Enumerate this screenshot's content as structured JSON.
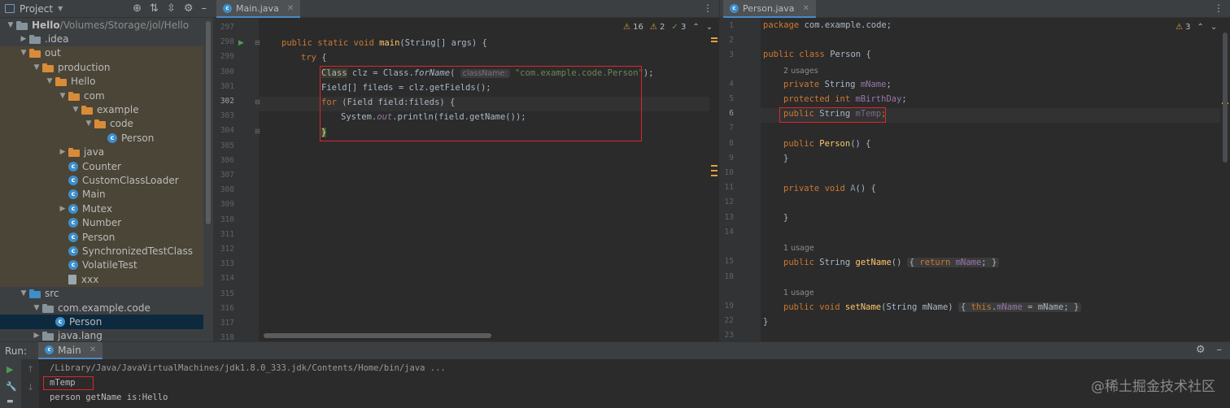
{
  "project": {
    "title": "Project",
    "tree": [
      {
        "label": "Hello",
        "extra": "/Volumes/Storage/jol/Hello",
        "indent": 0,
        "icon": "folder",
        "arrow": "down",
        "bold": true
      },
      {
        "label": ".idea",
        "indent": 1,
        "icon": "folder",
        "arrow": "right"
      },
      {
        "label": "out",
        "indent": 1,
        "icon": "folder-orange",
        "arrow": "down",
        "hl": true
      },
      {
        "label": "production",
        "indent": 2,
        "icon": "folder-orange",
        "arrow": "down",
        "hl": true
      },
      {
        "label": "Hello",
        "indent": 3,
        "icon": "folder-orange",
        "arrow": "down",
        "hl": true
      },
      {
        "label": "com",
        "indent": 4,
        "icon": "folder-orange",
        "arrow": "down",
        "hl": true
      },
      {
        "label": "example",
        "indent": 5,
        "icon": "folder-orange",
        "arrow": "down",
        "hl": true
      },
      {
        "label": "code",
        "indent": 6,
        "icon": "folder-orange",
        "arrow": "down",
        "hl": true
      },
      {
        "label": "Person",
        "indent": 7,
        "icon": "class",
        "arrow": "none",
        "hl": true
      },
      {
        "label": "java",
        "indent": 4,
        "icon": "folder-orange",
        "arrow": "right",
        "hl": true
      },
      {
        "label": "Counter",
        "indent": 4,
        "icon": "class",
        "arrow": "none",
        "hl": true
      },
      {
        "label": "CustomClassLoader",
        "indent": 4,
        "icon": "class",
        "arrow": "none",
        "hl": true
      },
      {
        "label": "Main",
        "indent": 4,
        "icon": "class",
        "arrow": "none",
        "hl": true
      },
      {
        "label": "Mutex",
        "indent": 4,
        "icon": "class",
        "arrow": "right",
        "hl": true
      },
      {
        "label": "Number",
        "indent": 4,
        "icon": "class",
        "arrow": "none",
        "hl": true
      },
      {
        "label": "Person",
        "indent": 4,
        "icon": "class",
        "arrow": "none",
        "hl": true
      },
      {
        "label": "SynchronizedTestClass",
        "indent": 4,
        "icon": "class",
        "arrow": "none",
        "hl": true
      },
      {
        "label": "VolatileTest",
        "indent": 4,
        "icon": "class",
        "arrow": "none",
        "hl": true
      },
      {
        "label": "xxx",
        "indent": 4,
        "icon": "file",
        "arrow": "none",
        "hl": true
      },
      {
        "label": "src",
        "indent": 1,
        "icon": "folder-blue",
        "arrow": "down"
      },
      {
        "label": "com.example.code",
        "indent": 2,
        "icon": "folder",
        "arrow": "down"
      },
      {
        "label": "Person",
        "indent": 3,
        "icon": "class",
        "arrow": "none",
        "selected": true
      },
      {
        "label": "java.lang",
        "indent": 2,
        "icon": "folder",
        "arrow": "right"
      }
    ]
  },
  "editor1": {
    "tab": "Main.java",
    "warnings": {
      "w": "16",
      "weak": "2",
      "ok": "3"
    },
    "line_numbers": [
      "297",
      "298",
      "299",
      "300",
      "301",
      "302",
      "303",
      "304",
      "305",
      "306",
      "307",
      "308",
      "309",
      "310",
      "311",
      "312",
      "313",
      "314",
      "315",
      "316",
      "317",
      "318"
    ],
    "current_line": "302",
    "code": {
      "l298_kw": "public static void ",
      "l298_fn": "main",
      "l298_rest": "(String[] args) {",
      "l299_kw": "try",
      "l299_rest": " {",
      "l300_a": "Class",
      "l300_b": " clz = Class.",
      "l300_c": "forName",
      "l300_d": "(",
      "l300_hint": "className:",
      "l300_str": "\"com.example.code.Person\"",
      "l300_e": ");",
      "l301": "Field[] fileds = clz.getFields();",
      "l302_kw": "for",
      "l302_rest": " (Field field:fileds) {",
      "l303_a": "System.",
      "l303_out": "out",
      "l303_b": ".println(field.getName());",
      "l304": "}"
    }
  },
  "editor2": {
    "tab": "Person.java",
    "warnings": "3",
    "line_numbers": [
      "1",
      "2",
      "3",
      "",
      "4",
      "5",
      "6",
      "7",
      "8",
      "9",
      "10",
      "11",
      "12",
      "13",
      "14",
      "",
      "15",
      "18",
      "",
      "19",
      "22",
      "23"
    ],
    "current_line": "6",
    "code": {
      "l1_kw": "package",
      "l1_rest": " com.example.code;",
      "l3_kw": "public class ",
      "l3_rest": "Person {",
      "u1": "2 usages",
      "l4_kw": "private ",
      "l4_t": "String ",
      "l4_f": "mName",
      "l4_s": ";",
      "l5_kw": "protected int ",
      "l5_f": "mBirthDay",
      "l5_s": ";",
      "l6_kw": "public ",
      "l6_t": "String ",
      "l6_f": "mTemp",
      "l6_s": ";",
      "l8_kw": "public ",
      "l8_fn": "Person",
      "l8_rest": "() {",
      "l9": "}",
      "l11_kw": "private void ",
      "l11_fn": "A",
      "l11_rest": "() {",
      "l13": "}",
      "u2": "1 usage",
      "l15_kw": "public ",
      "l15_t": "String ",
      "l15_fn": "getName",
      "l15_p": "() ",
      "l15_h1": "{ ",
      "l15_ret": "return ",
      "l15_f": "mName",
      "l15_h2": "; }",
      "u3": "1 usage",
      "l19_kw": "public void ",
      "l19_fn": "setName",
      "l19_p": "(String mName) ",
      "l19_h1": "{ ",
      "l19_this": "this",
      "l19_dot": ".",
      "l19_f": "mName",
      "l19_rest": " = mName; }",
      "l22": "}"
    }
  },
  "run": {
    "label": "Run:",
    "tab": "Main",
    "lines": [
      "/Library/Java/JavaVirtualMachines/jdk1.8.0_333.jdk/Contents/Home/bin/java ...",
      "mTemp",
      "person getName is:Hello"
    ]
  },
  "watermark": "@稀土掘金技术社区",
  "colors": {
    "accent": "#4a88c7",
    "highlight_box": "#e0252b",
    "keyword": "#cc7832",
    "function": "#ffc66d",
    "string": "#6a8759",
    "field": "#9876aa"
  }
}
